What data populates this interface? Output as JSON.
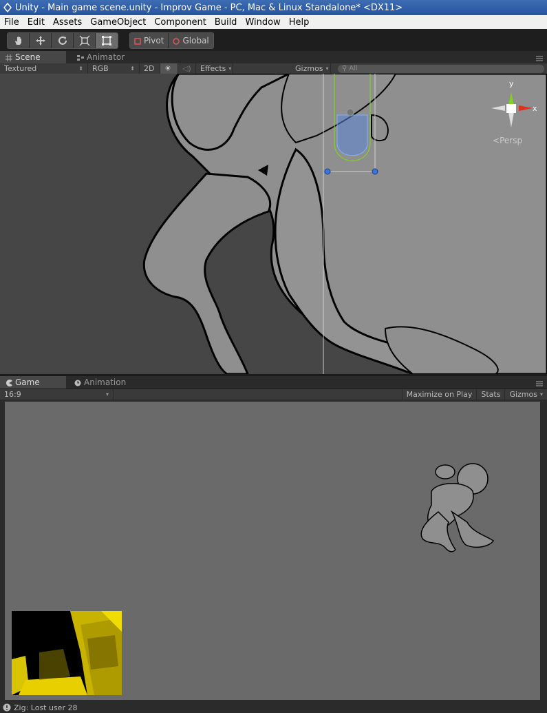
{
  "window": {
    "title": "Unity - Main game scene.unity - Improv Game - PC, Mac & Linux Standalone* <DX11>"
  },
  "menu": [
    "File",
    "Edit",
    "Assets",
    "GameObject",
    "Component",
    "Build",
    "Window",
    "Help"
  ],
  "toolbar": {
    "tools": [
      {
        "icon": "hand-icon"
      },
      {
        "icon": "move-icon"
      },
      {
        "icon": "rotate-icon"
      },
      {
        "icon": "scale-icon"
      },
      {
        "icon": "rect-icon",
        "active": true
      }
    ],
    "pivot_label": "Pivot",
    "global_label": "Global"
  },
  "scene_panel": {
    "tabs": [
      "Scene",
      "Animator"
    ],
    "draw_mode": "Textured",
    "channel": "RGB",
    "mode_2d": "2D",
    "effects_label": "Effects",
    "gizmos_label": "Gizmos",
    "search_placeholder": "All",
    "gizmo": {
      "y_label": "y",
      "x_label": "x",
      "projection": "Persp"
    }
  },
  "game_panel": {
    "tabs": [
      "Game",
      "Animation"
    ],
    "aspect": "16:9",
    "maximize_label": "Maximize on Play",
    "stats_label": "Stats",
    "gizmos_label": "Gizmos"
  },
  "status": {
    "message": "Zig: Lost user 28"
  },
  "colors": {
    "accent_title": "#2654a0",
    "scene_bg": "#464646",
    "game_bg": "#6a6a6a",
    "depth_highlight": "#e8d000",
    "gizmo_x": "#e0301e",
    "gizmo_y": "#7ed321"
  }
}
